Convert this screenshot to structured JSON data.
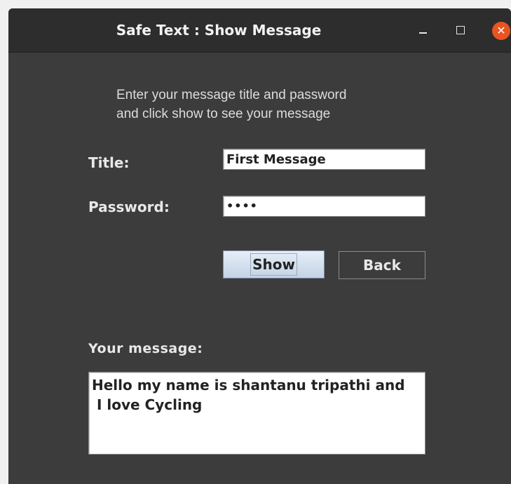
{
  "window": {
    "title": "Safe Text : Show Message",
    "controls": {
      "minimize_icon": "minimize-icon",
      "maximize_icon": "maximize-icon",
      "close_icon": "close-icon",
      "close_glyph": "✕"
    },
    "close_color": "#e95420",
    "background_color": "#3c3c3c"
  },
  "instructions": {
    "line1": "Enter your message title and password",
    "line2": "and click show to see your message"
  },
  "form": {
    "title_label": "Title:",
    "title_value": "First Message",
    "password_label": "Password:",
    "password_value": "••••"
  },
  "buttons": {
    "show_label": "Show",
    "back_label": "Back"
  },
  "message": {
    "label": "Your message:",
    "text": "Hello my name is shantanu tripathi and\n I love Cycling"
  }
}
